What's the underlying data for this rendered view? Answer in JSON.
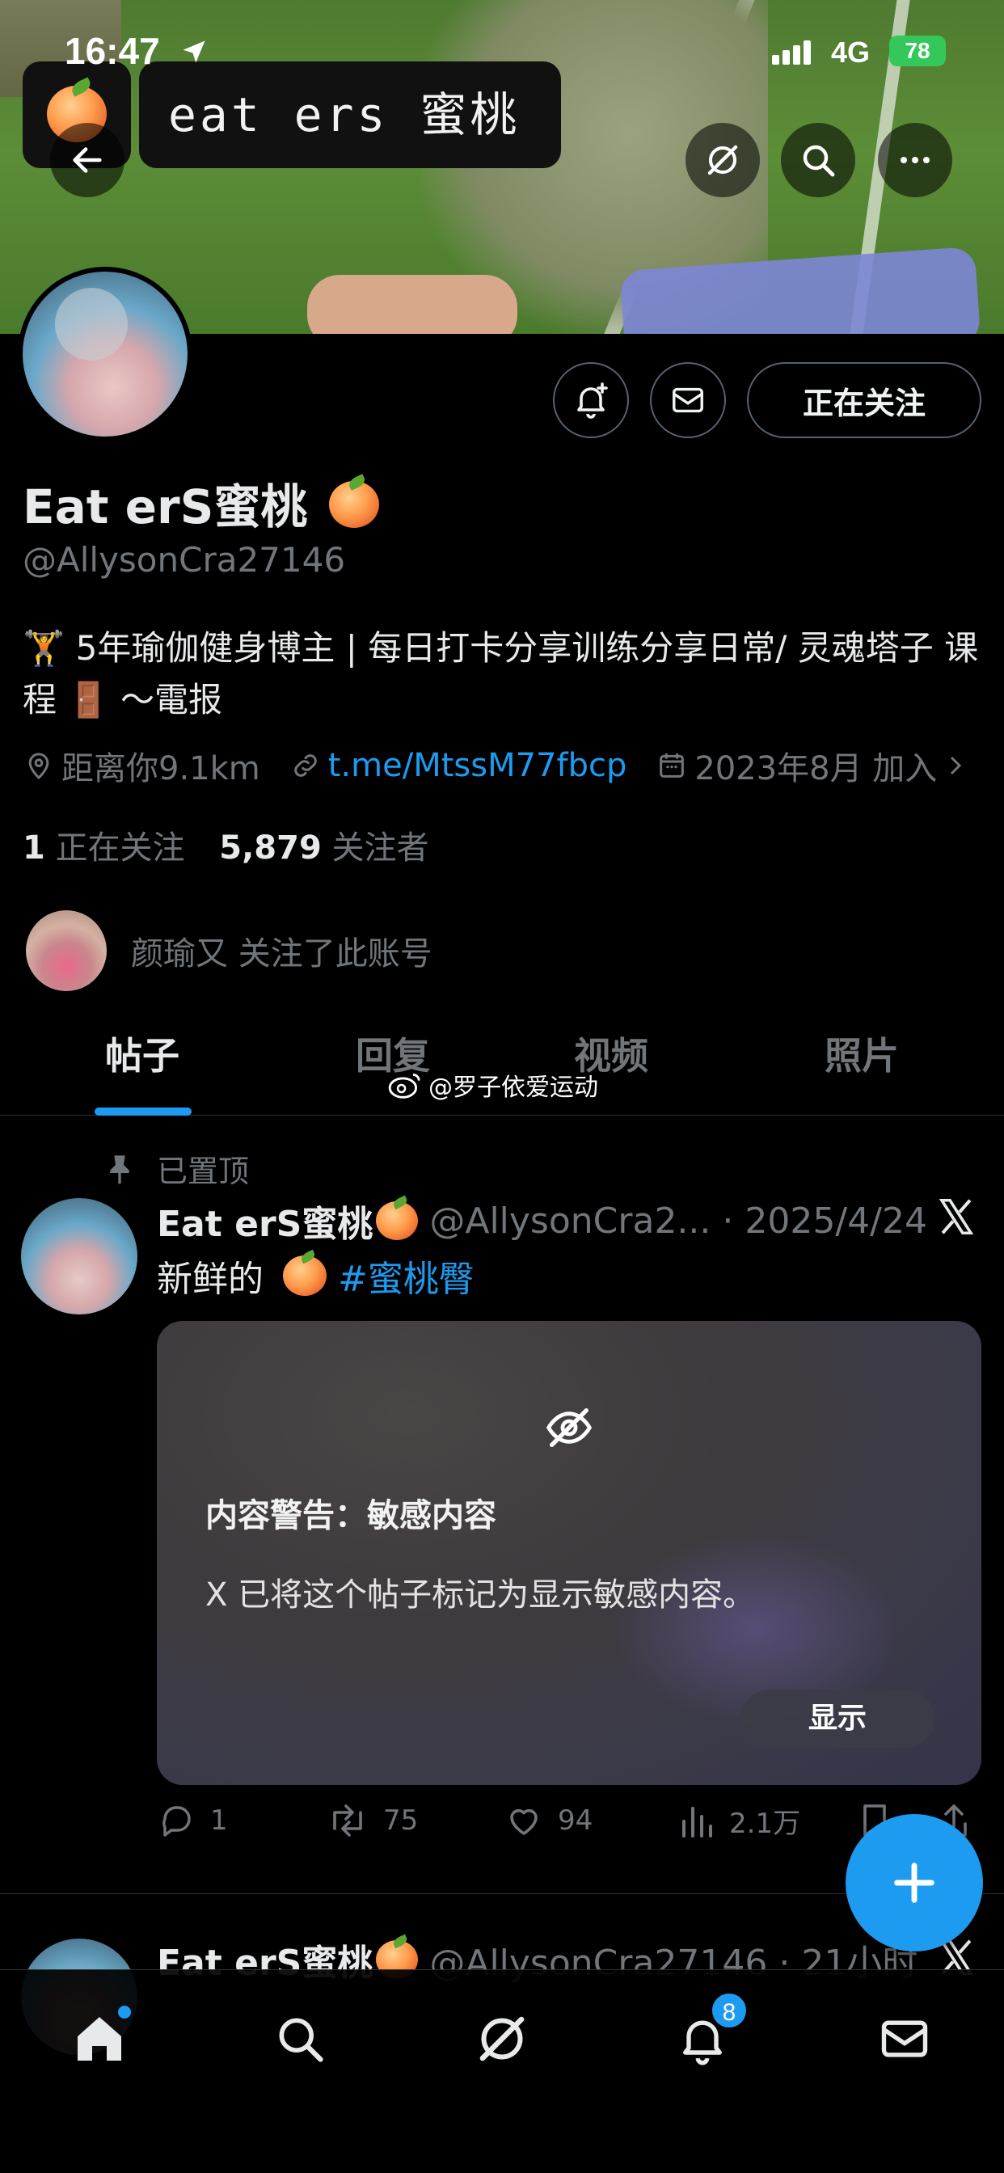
{
  "status_bar": {
    "time": "16:47",
    "network": "4G",
    "battery": "78"
  },
  "banner": {
    "watermark_text": "eat ers 蜜桃"
  },
  "profile": {
    "display_name": "Eat erS蜜桃",
    "handle": "@AllysonCra27146",
    "follow_button": "正在关注",
    "bio": "🏋️ 5年瑜伽健身博主 | 每日打卡分享训练分享日常/ 灵魂塔子 课程 🚪 ～電报",
    "location": "距离你9.1km",
    "link": "t.me/MtssM77fbcp",
    "joined": "2023年8月 加入",
    "following_count": "1",
    "following_label": "正在关注",
    "followers_count": "5,879",
    "followers_label": "关注者",
    "followed_by": "颜瑜又 关注了此账号"
  },
  "tabs": [
    {
      "label": "帖子"
    },
    {
      "label": "回复"
    },
    {
      "label": "视频"
    },
    {
      "label": "照片"
    }
  ],
  "watermark": "@罗子依爱运动",
  "pinned_tweet": {
    "pinned_label": "已置顶",
    "name": "Eat erS蜜桃",
    "handle_date": "@AllysonCra2... · 2025/4/24",
    "text": "新鲜的",
    "hashtag": "#蜜桃臀",
    "warning_title": "内容警告：敏感内容",
    "warning_desc": "X 已将这个帖子标记为显示敏感内容。",
    "show_button": "显示",
    "replies": "1",
    "retweets": "75",
    "likes": "94",
    "views": "2.1万"
  },
  "next_tweet": {
    "name": "Eat erS蜜桃",
    "handle_time": "@AllysonCra27146 · 21小时"
  },
  "bottom_nav": {
    "notifications_badge": "8"
  },
  "colors": {
    "accent": "#1d9bf0",
    "muted": "#71767b",
    "text": "#e7e9ea",
    "divider": "#2f3336"
  }
}
